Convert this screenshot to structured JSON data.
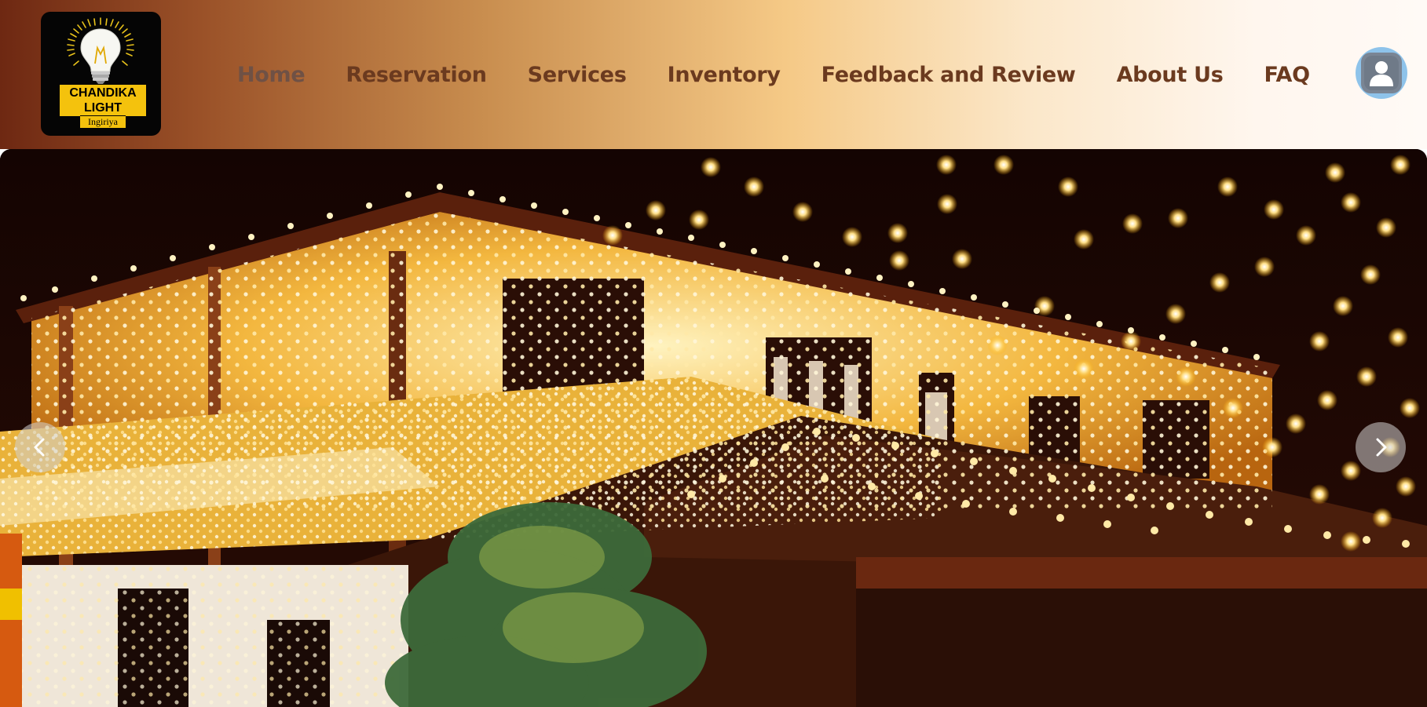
{
  "logo": {
    "name": "CHANDIKA LIGHT",
    "location": "Ingiriya",
    "icon": "light-bulb-icon"
  },
  "nav": {
    "items": [
      {
        "label": "Home"
      },
      {
        "label": "Reservation"
      },
      {
        "label": "Services"
      },
      {
        "label": "Inventory"
      },
      {
        "label": "Feedback and Review"
      },
      {
        "label": "About Us"
      },
      {
        "label": "FAQ"
      }
    ],
    "active": "Home"
  },
  "profile": {
    "icon": "user-avatar-icon"
  },
  "carousel": {
    "prev_icon": "chevron-left-icon",
    "next_icon": "chevron-right-icon",
    "slide": "house-decorated-with-string-lights"
  },
  "colors": {
    "nav_text": "#6b3a1f",
    "header_start": "#6e2812",
    "header_end": "#fffaf6",
    "profile_ring": "#8ec3ea"
  }
}
